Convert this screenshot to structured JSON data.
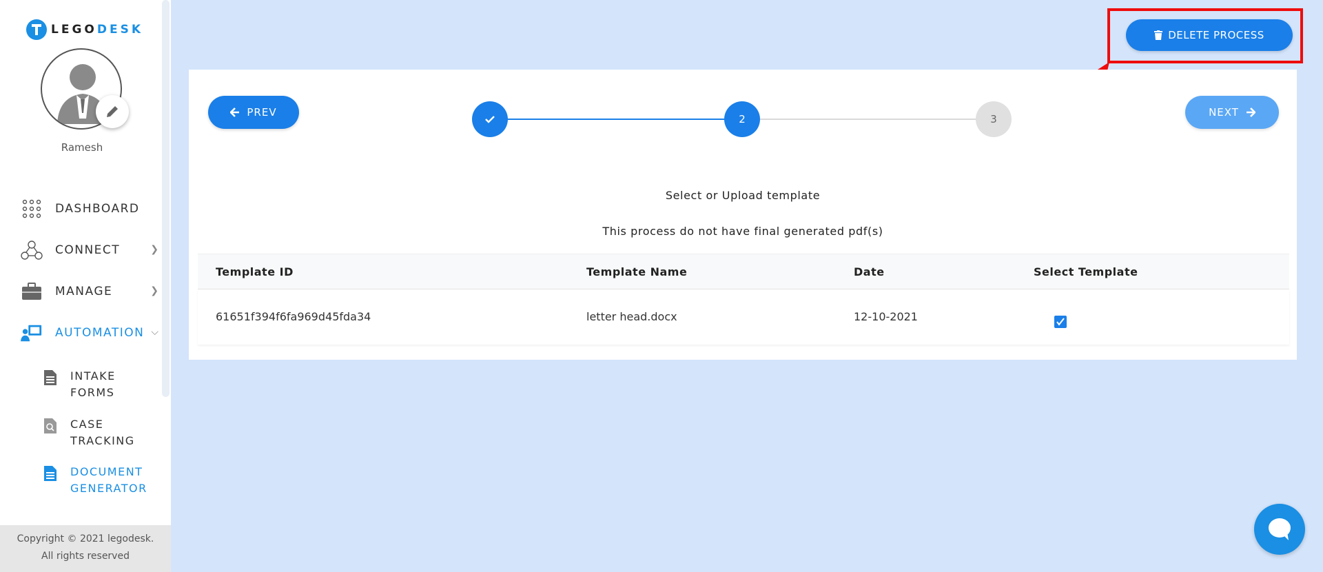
{
  "brand": {
    "lego": "LEGO",
    "desk": "DESK"
  },
  "user": {
    "name": "Ramesh"
  },
  "nav": [
    {
      "label": "DASHBOARD",
      "icon": "grid-dots-icon"
    },
    {
      "label": "CONNECT",
      "icon": "network-icon"
    },
    {
      "label": "MANAGE",
      "icon": "briefcase-icon"
    },
    {
      "label": "AUTOMATION",
      "icon": "automation-monitor-icon"
    }
  ],
  "subnav": [
    {
      "line1": "INTAKE",
      "line2": "FORMS",
      "icon": "document-icon"
    },
    {
      "line1": "CASE",
      "line2": "TRACKING",
      "icon": "document-search-icon"
    },
    {
      "line1": "DOCUMENT",
      "line2": "GENERATOR",
      "icon": "document-blue-icon"
    }
  ],
  "footer": {
    "line1": "Copyright © 2021 legodesk.",
    "line2": "All rights reserved"
  },
  "actions": {
    "delete_label": "DELETE PROCESS",
    "prev_label": "PREV",
    "next_label": "NEXT"
  },
  "stepper": {
    "step2": "2",
    "step3": "3"
  },
  "content": {
    "heading": "Select or Upload template",
    "message": "This process do not have final generated pdf(s)"
  },
  "table": {
    "headers": [
      "Template ID",
      "Template Name",
      "Date",
      "Select Template"
    ],
    "rows": [
      {
        "id": "61651f394f6fa969d45fda34",
        "name": "letter head.docx",
        "date": "12-10-2021",
        "selected": true
      }
    ]
  },
  "colors": {
    "primary": "#1a7fe8",
    "accent": "#1a8fe3",
    "highlight": "#ee0d0d",
    "background": "#d3e4fb"
  }
}
